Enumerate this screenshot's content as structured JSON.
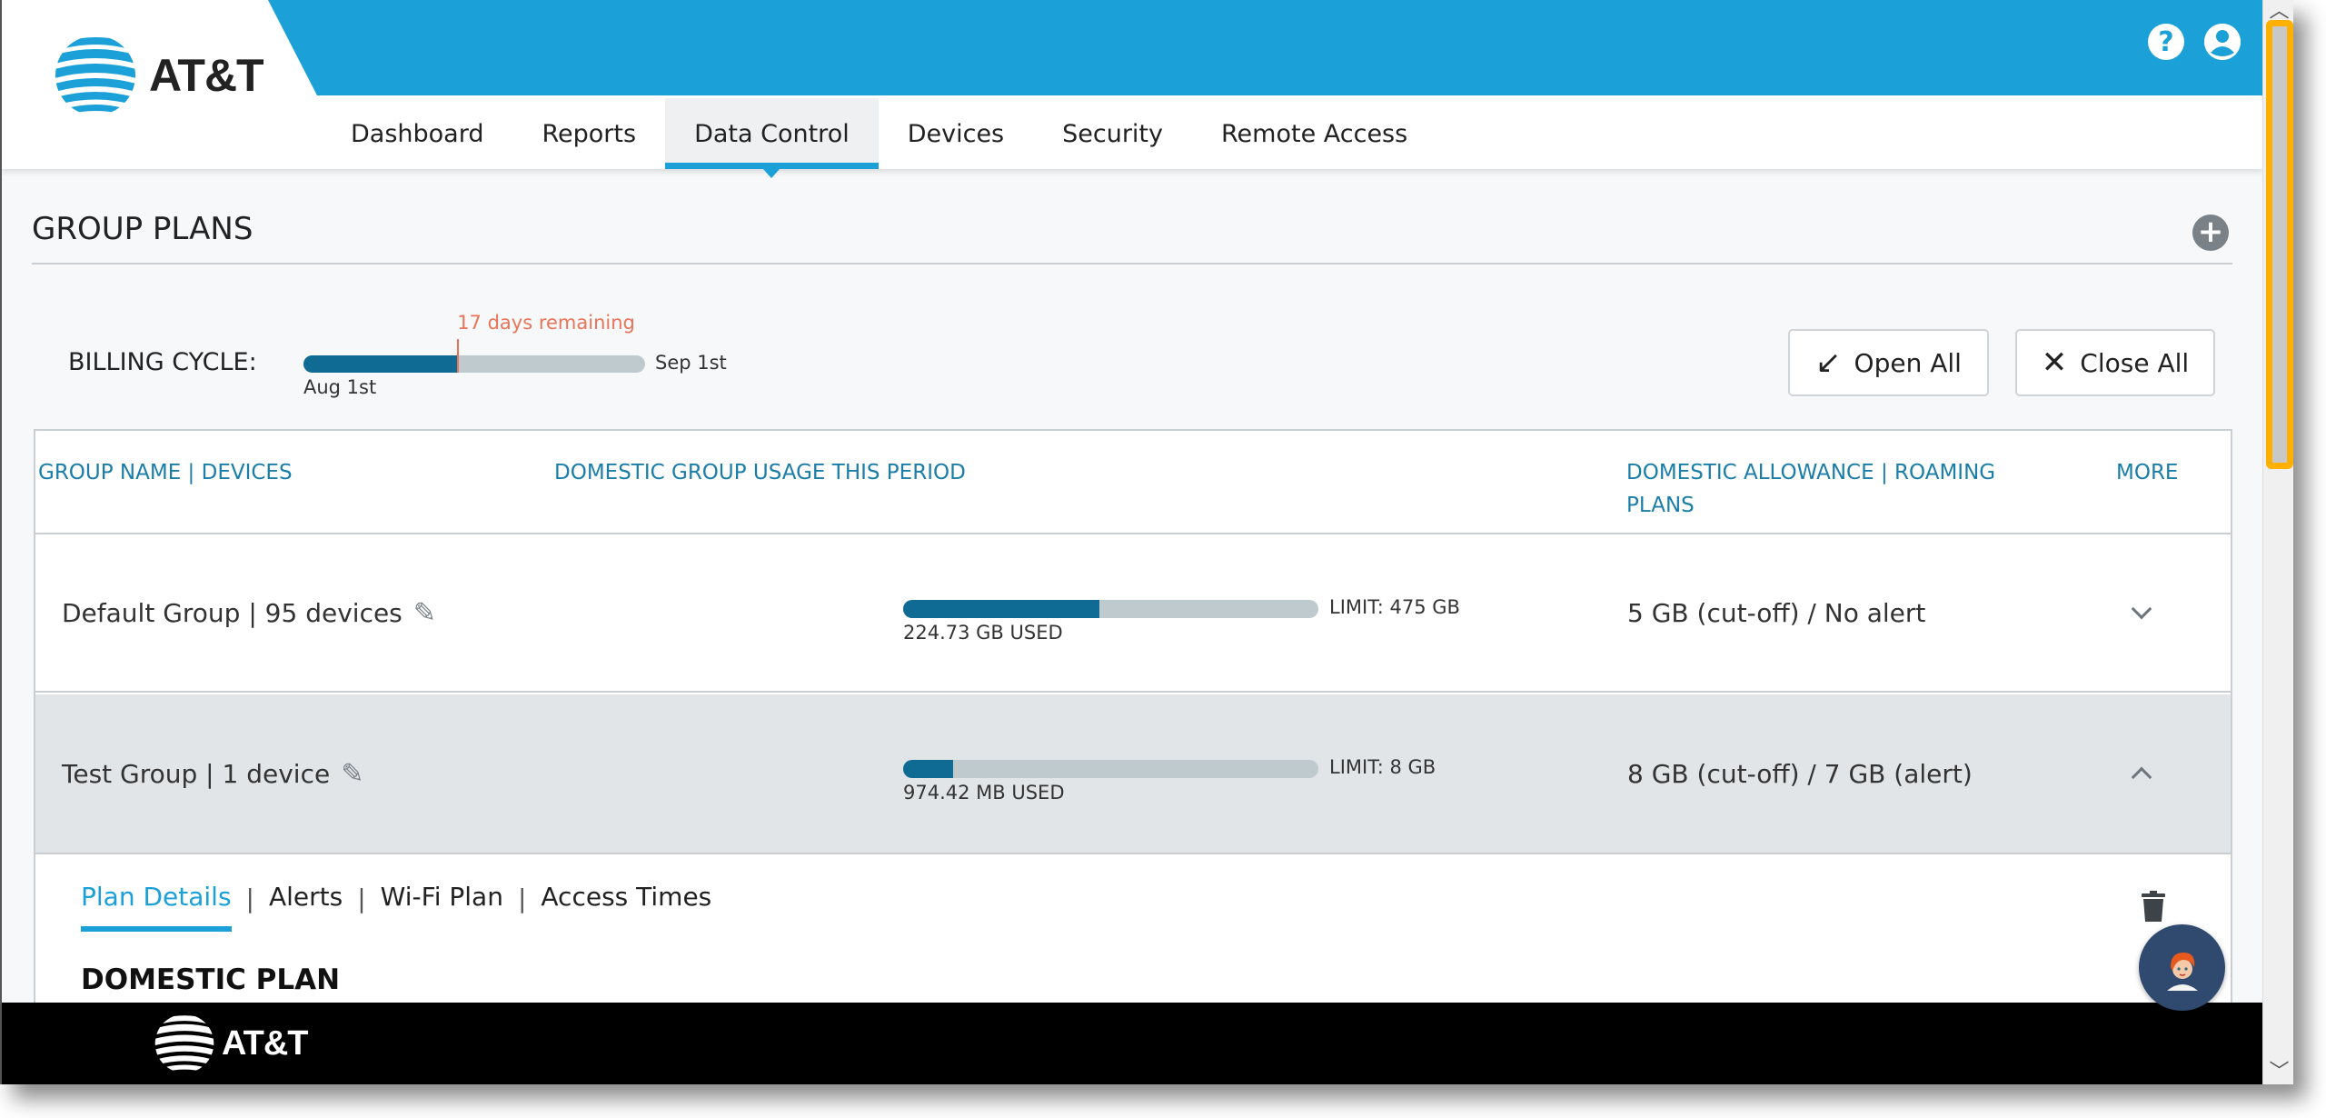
{
  "header": {
    "brand": "AT&T",
    "nav_tabs": [
      {
        "label": "Dashboard",
        "active": false
      },
      {
        "label": "Reports",
        "active": false
      },
      {
        "label": "Data Control",
        "active": true
      },
      {
        "label": "Devices",
        "active": false
      },
      {
        "label": "Security",
        "active": false
      },
      {
        "label": "Remote Access",
        "active": false
      }
    ],
    "icons": {
      "help": "?",
      "user": "user-icon"
    }
  },
  "colors": {
    "brand_blue": "#1ba0d8",
    "bar_fill": "#0f6b93",
    "bar_track": "#bfcacf",
    "accent_orange": "#e8755a",
    "highlight": "#ffb000"
  },
  "section": {
    "title": "GROUP PLANS",
    "add_icon": "+"
  },
  "billing": {
    "label": "BILLING CYCLE:",
    "start": "Aug 1st",
    "end": "Sep 1st",
    "remaining": "17 days remaining",
    "progress_fraction": 0.45
  },
  "buttons": {
    "open_all": "Open All",
    "open_icon": "↙",
    "close_all": "Close All",
    "close_icon": "✕"
  },
  "table": {
    "headers": [
      "GROUP NAME | DEVICES",
      "DOMESTIC GROUP USAGE THIS PERIOD",
      "DOMESTIC ALLOWANCE | ROAMING PLANS",
      "MORE"
    ],
    "rows": [
      {
        "name": "Default Group | 95 devices",
        "used": "224.73 GB USED",
        "limit": "LIMIT: 475 GB",
        "usage_fraction": 0.473,
        "allowance": "5 GB (cut-off) / No alert",
        "expanded": false
      },
      {
        "name": "Test Group | 1 device",
        "used": "974.42 MB USED",
        "limit": "LIMIT: 8 GB",
        "usage_fraction": 0.12,
        "allowance": "8 GB (cut-off) / 7 GB (alert)",
        "expanded": true
      }
    ]
  },
  "panel": {
    "subtabs": [
      {
        "label": "Plan Details",
        "active": true
      },
      {
        "label": "Alerts",
        "active": false
      },
      {
        "label": "Wi-Fi Plan",
        "active": false
      },
      {
        "label": "Access Times",
        "active": false
      }
    ],
    "domestic_title": "DOMESTIC PLAN"
  },
  "footer": {
    "brand": "AT&T"
  },
  "scrollbar": {
    "up": "^",
    "down": "v"
  }
}
